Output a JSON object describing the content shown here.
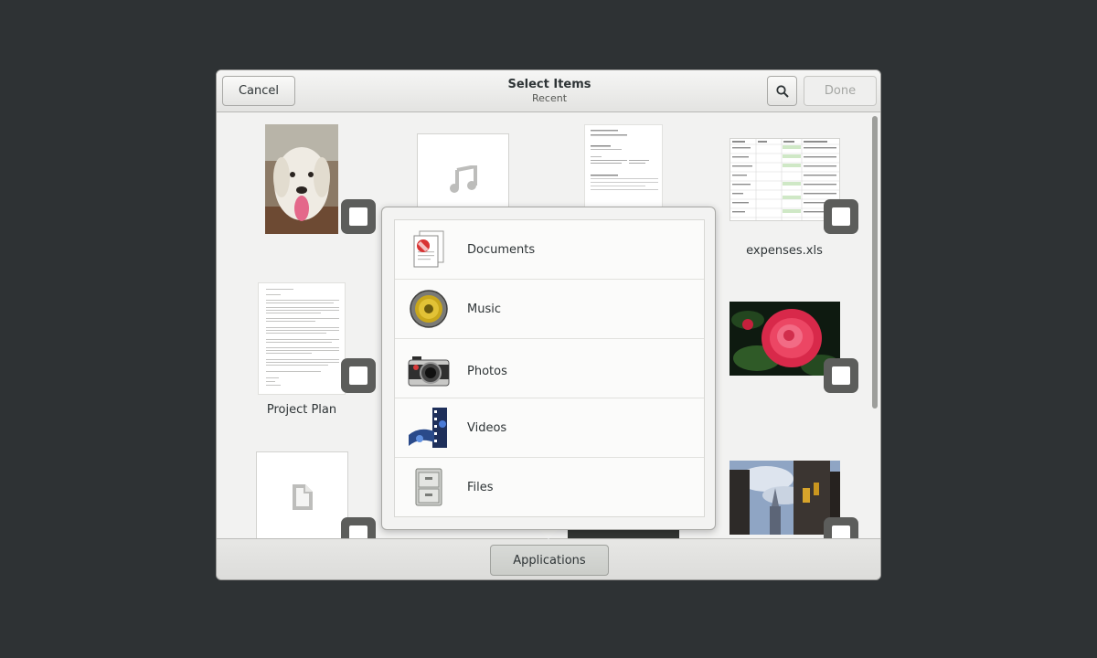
{
  "header": {
    "cancel_label": "Cancel",
    "title": "Select Items",
    "subtitle": "Recent",
    "done_label": "Done"
  },
  "grid": {
    "captions": [
      "expenses.xls",
      "Project Plan"
    ]
  },
  "popover": {
    "items": [
      {
        "label": "Documents",
        "icon": "documents-icon"
      },
      {
        "label": "Music",
        "icon": "music-icon"
      },
      {
        "label": "Photos",
        "icon": "photos-icon"
      },
      {
        "label": "Videos",
        "icon": "videos-icon"
      },
      {
        "label": "Files",
        "icon": "files-icon"
      }
    ]
  },
  "footer": {
    "applications_label": "Applications"
  },
  "colors": {
    "background": "#2e3234",
    "dialog": "#f2f2f1",
    "check_overlay": "#5c5d5b",
    "flower": "#e0304e"
  }
}
